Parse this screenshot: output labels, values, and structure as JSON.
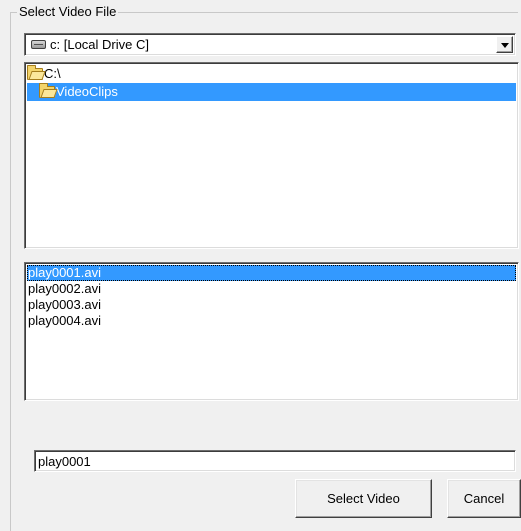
{
  "window": {
    "group_title": "Select Video File"
  },
  "drive_selector": {
    "selected": "c: [Local Drive C]",
    "icon": "hard-drive-icon"
  },
  "folders": {
    "items": [
      {
        "label": "C:\\",
        "icon": "open-folder-icon",
        "selected": false
      },
      {
        "label": "VideoClips",
        "icon": "open-folder-icon",
        "selected": true
      }
    ]
  },
  "files": {
    "items": [
      {
        "label": "play0001.avi",
        "selected": true
      },
      {
        "label": "play0002.avi",
        "selected": false
      },
      {
        "label": "play0003.avi",
        "selected": false
      },
      {
        "label": "play0004.avi",
        "selected": false
      }
    ]
  },
  "filename_field": {
    "value": "play0001"
  },
  "buttons": {
    "select_label": "Select Video",
    "cancel_label": "Cancel"
  },
  "colors": {
    "selection": "#3399ff",
    "background": "#f0f0f0"
  }
}
